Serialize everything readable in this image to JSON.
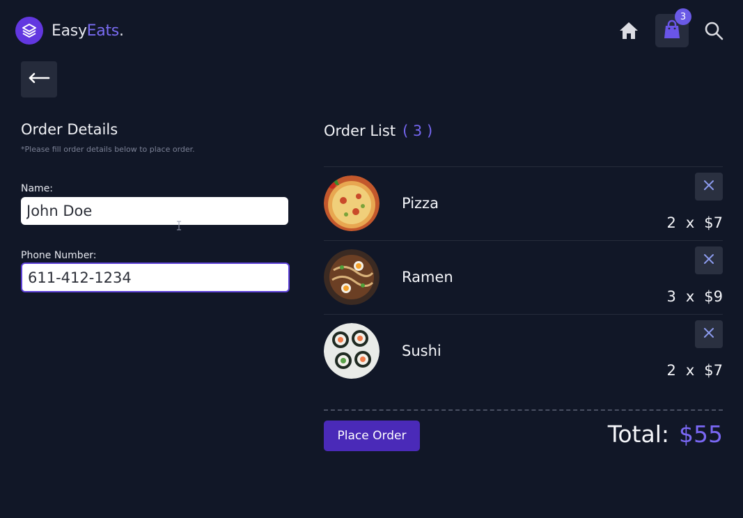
{
  "app": {
    "logo_part1": "Easy",
    "logo_part2": "Eats",
    "logo_part3": "."
  },
  "nav": {
    "cart_count": "3"
  },
  "order_details": {
    "title": "Order Details",
    "hint": "*Please fill order details below to place order.",
    "name_label": "Name:",
    "name_value": "John Doe",
    "phone_label": "Phone Number:",
    "phone_value": "611-412-1234"
  },
  "order_list": {
    "title": "Order List",
    "count": "( 3 )",
    "items": [
      {
        "name": "Pizza",
        "qty": "2",
        "x": "x",
        "price": "$7"
      },
      {
        "name": "Ramen",
        "qty": "3",
        "x": "x",
        "price": "$9"
      },
      {
        "name": "Sushi",
        "qty": "2",
        "x": "x",
        "price": "$7"
      }
    ]
  },
  "footer": {
    "place_order_label": "Place Order",
    "total_label": "Total:",
    "total_amount": "$55"
  },
  "colors": {
    "background": "#111727",
    "accent": "#6237e0",
    "accent_text": "#7a68f5",
    "button": "#4a2ab8"
  },
  "icons": [
    "layers-icon",
    "home-icon",
    "shopping-bag-icon",
    "search-icon",
    "arrow-left-icon",
    "close-icon"
  ]
}
